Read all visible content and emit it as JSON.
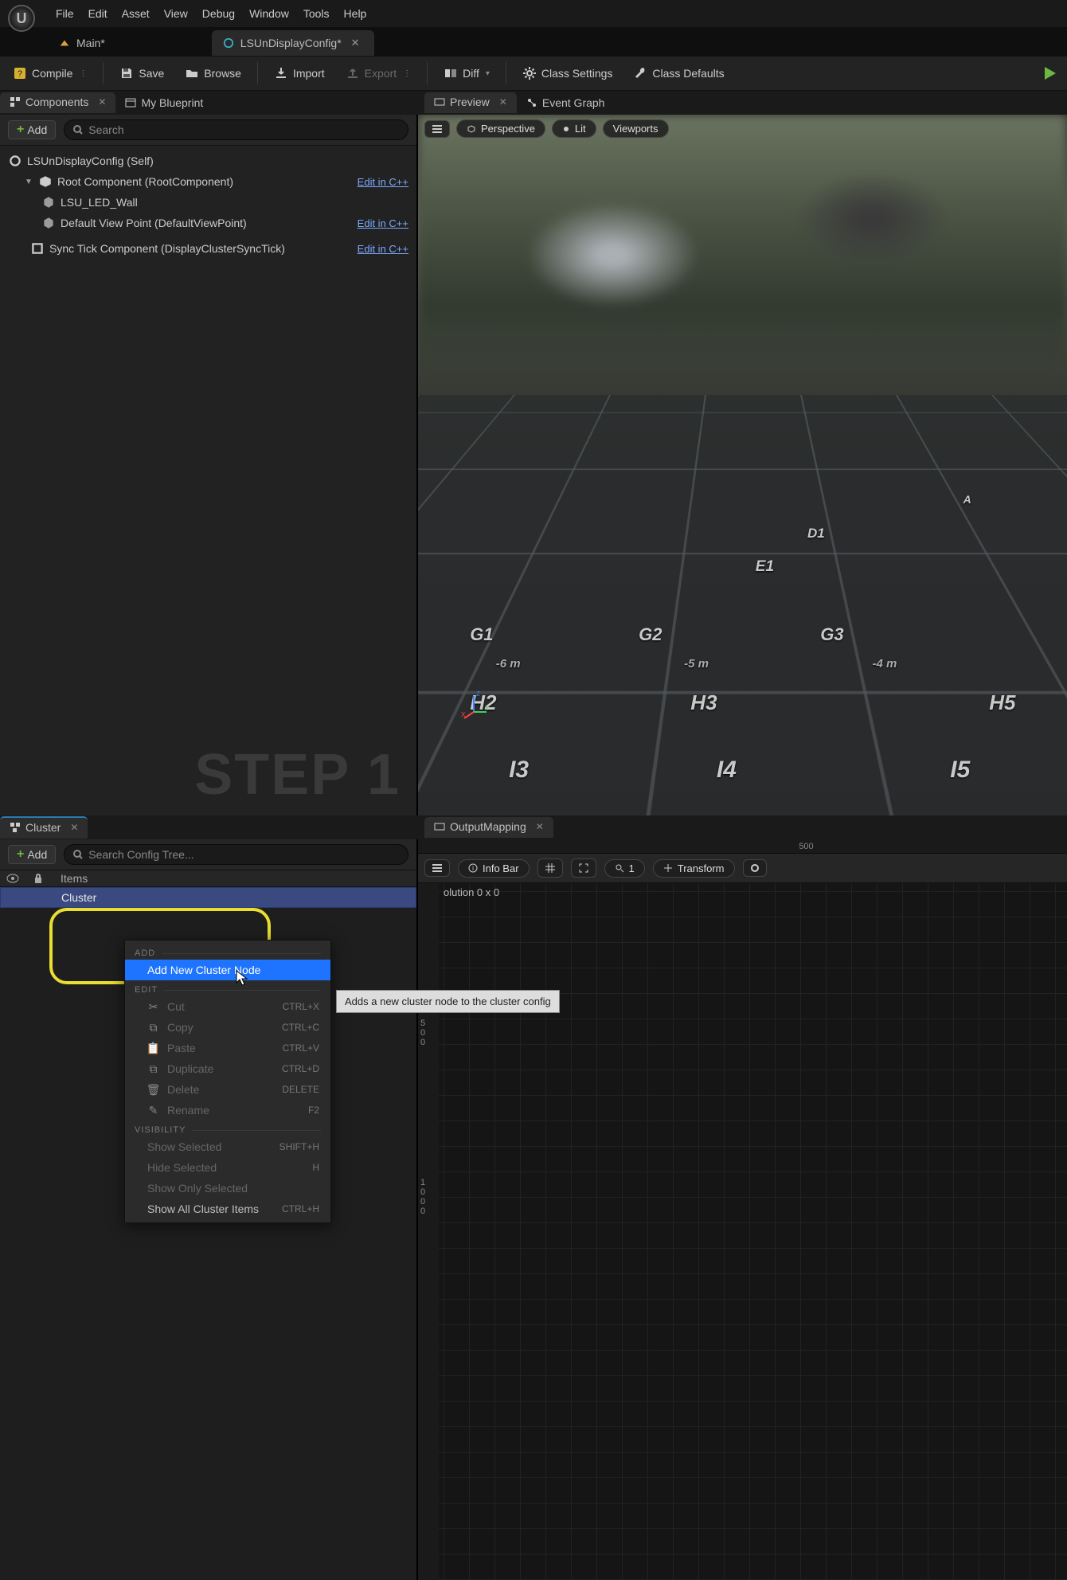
{
  "menu": {
    "file": "File",
    "edit": "Edit",
    "asset": "Asset",
    "view": "View",
    "debug": "Debug",
    "window": "Window",
    "tools": "Tools",
    "help": "Help"
  },
  "tabs": {
    "main": "Main*",
    "active": "LSUnDisplayConfig*"
  },
  "toolbar": {
    "compile": "Compile",
    "save": "Save",
    "browse": "Browse",
    "import": "Import",
    "export": "Export",
    "diff": "Diff",
    "class_settings": "Class Settings",
    "class_defaults": "Class Defaults"
  },
  "panels": {
    "components": "Components",
    "my_blueprint": "My Blueprint",
    "preview": "Preview",
    "event_graph": "Event Graph",
    "cluster": "Cluster",
    "output_mapping": "OutputMapping"
  },
  "add_label": "Add",
  "search_placeholder": "Search",
  "search_config_placeholder": "Search Config Tree...",
  "components_tree": {
    "self": "LSUnDisplayConfig (Self)",
    "root": "Root Component (RootComponent)",
    "led": "LSU_LED_Wall",
    "dvp": "Default View Point (DefaultViewPoint)",
    "sync": "Sync Tick Component (DisplayClusterSyncTick)",
    "edit": "Edit in C++"
  },
  "viewport_toolbar": {
    "perspective": "Perspective",
    "lit": "Lit",
    "viewports": "Viewports"
  },
  "step_label": "STEP 1",
  "floor": {
    "d1": "D1",
    "e1": "E1",
    "g1": "G1",
    "g2": "G2",
    "g3": "G3",
    "m6": "-6 m",
    "m5": "-5 m",
    "m4": "-4 m",
    "h2": "H2",
    "h3": "H3",
    "h5": "H5",
    "i3": "I3",
    "i4": "I4",
    "i5": "I5",
    "a": "A"
  },
  "cluster": {
    "items_header": "Items",
    "root": "Cluster"
  },
  "context_menu": {
    "section_add": "ADD",
    "add_node": "Add New Cluster Node",
    "section_edit": "EDIT",
    "cut": "Cut",
    "cut_kb": "CTRL+X",
    "copy": "Copy",
    "copy_kb": "CTRL+C",
    "paste": "Paste",
    "paste_kb": "CTRL+V",
    "duplicate": "Duplicate",
    "duplicate_kb": "CTRL+D",
    "delete": "Delete",
    "delete_kb": "DELETE",
    "rename": "Rename",
    "rename_kb": "F2",
    "section_vis": "VISIBILITY",
    "show_selected": "Show Selected",
    "show_selected_kb": "SHIFT+H",
    "hide_selected": "Hide Selected",
    "hide_selected_kb": "H",
    "show_only": "Show Only Selected",
    "show_all": "Show All Cluster Items",
    "show_all_kb": "CTRL+H"
  },
  "tooltip": "Adds a new cluster node to the cluster config",
  "output_mapping": {
    "ruler_top": "500",
    "info_bar": "Info Bar",
    "zoom": "1",
    "transform": "Transform",
    "resolution": "olution 0 x 0",
    "tick_500": "5\n0\n0",
    "tick_1000": "1\n0\n0\n0"
  }
}
